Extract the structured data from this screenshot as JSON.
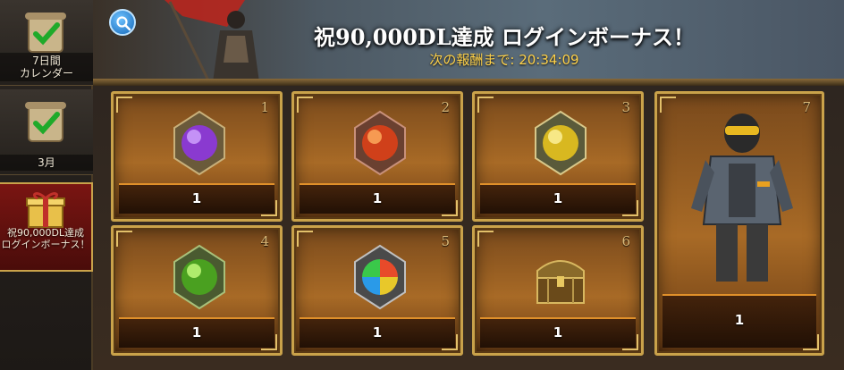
{
  "sidebar": {
    "tabs": [
      {
        "label": "7日間\nカレンダー",
        "icon": "scroll-check-icon"
      },
      {
        "label": "3月",
        "icon": "scroll-check-icon"
      },
      {
        "label": "祝90,000DL達成\nログインボーナス！",
        "icon": "gift-box-icon"
      }
    ]
  },
  "header": {
    "title": "祝90,000DL達成 ログインボーナス！",
    "subtitle": "次の報酬まで: 20:34:09"
  },
  "rewards": [
    {
      "day": "1",
      "qty": "1",
      "item": "purple-gem-medallion-icon"
    },
    {
      "day": "2",
      "qty": "1",
      "item": "red-gem-medallion-icon"
    },
    {
      "day": "3",
      "qty": "1",
      "item": "gold-gem-medallion-icon"
    },
    {
      "day": "4",
      "qty": "1",
      "item": "green-gem-medallion-icon"
    },
    {
      "day": "5",
      "qty": "1",
      "item": "rainbow-gem-medallion-icon"
    },
    {
      "day": "6",
      "qty": "1",
      "item": "treasure-chest-icon"
    },
    {
      "day": "7",
      "qty": "1",
      "item": "armored-knight-costume-icon"
    }
  ],
  "colors": {
    "accent_gold": "#c9a24a",
    "subtitle_yellow": "#ffd24a",
    "active_tab_red": "#7a1512"
  }
}
